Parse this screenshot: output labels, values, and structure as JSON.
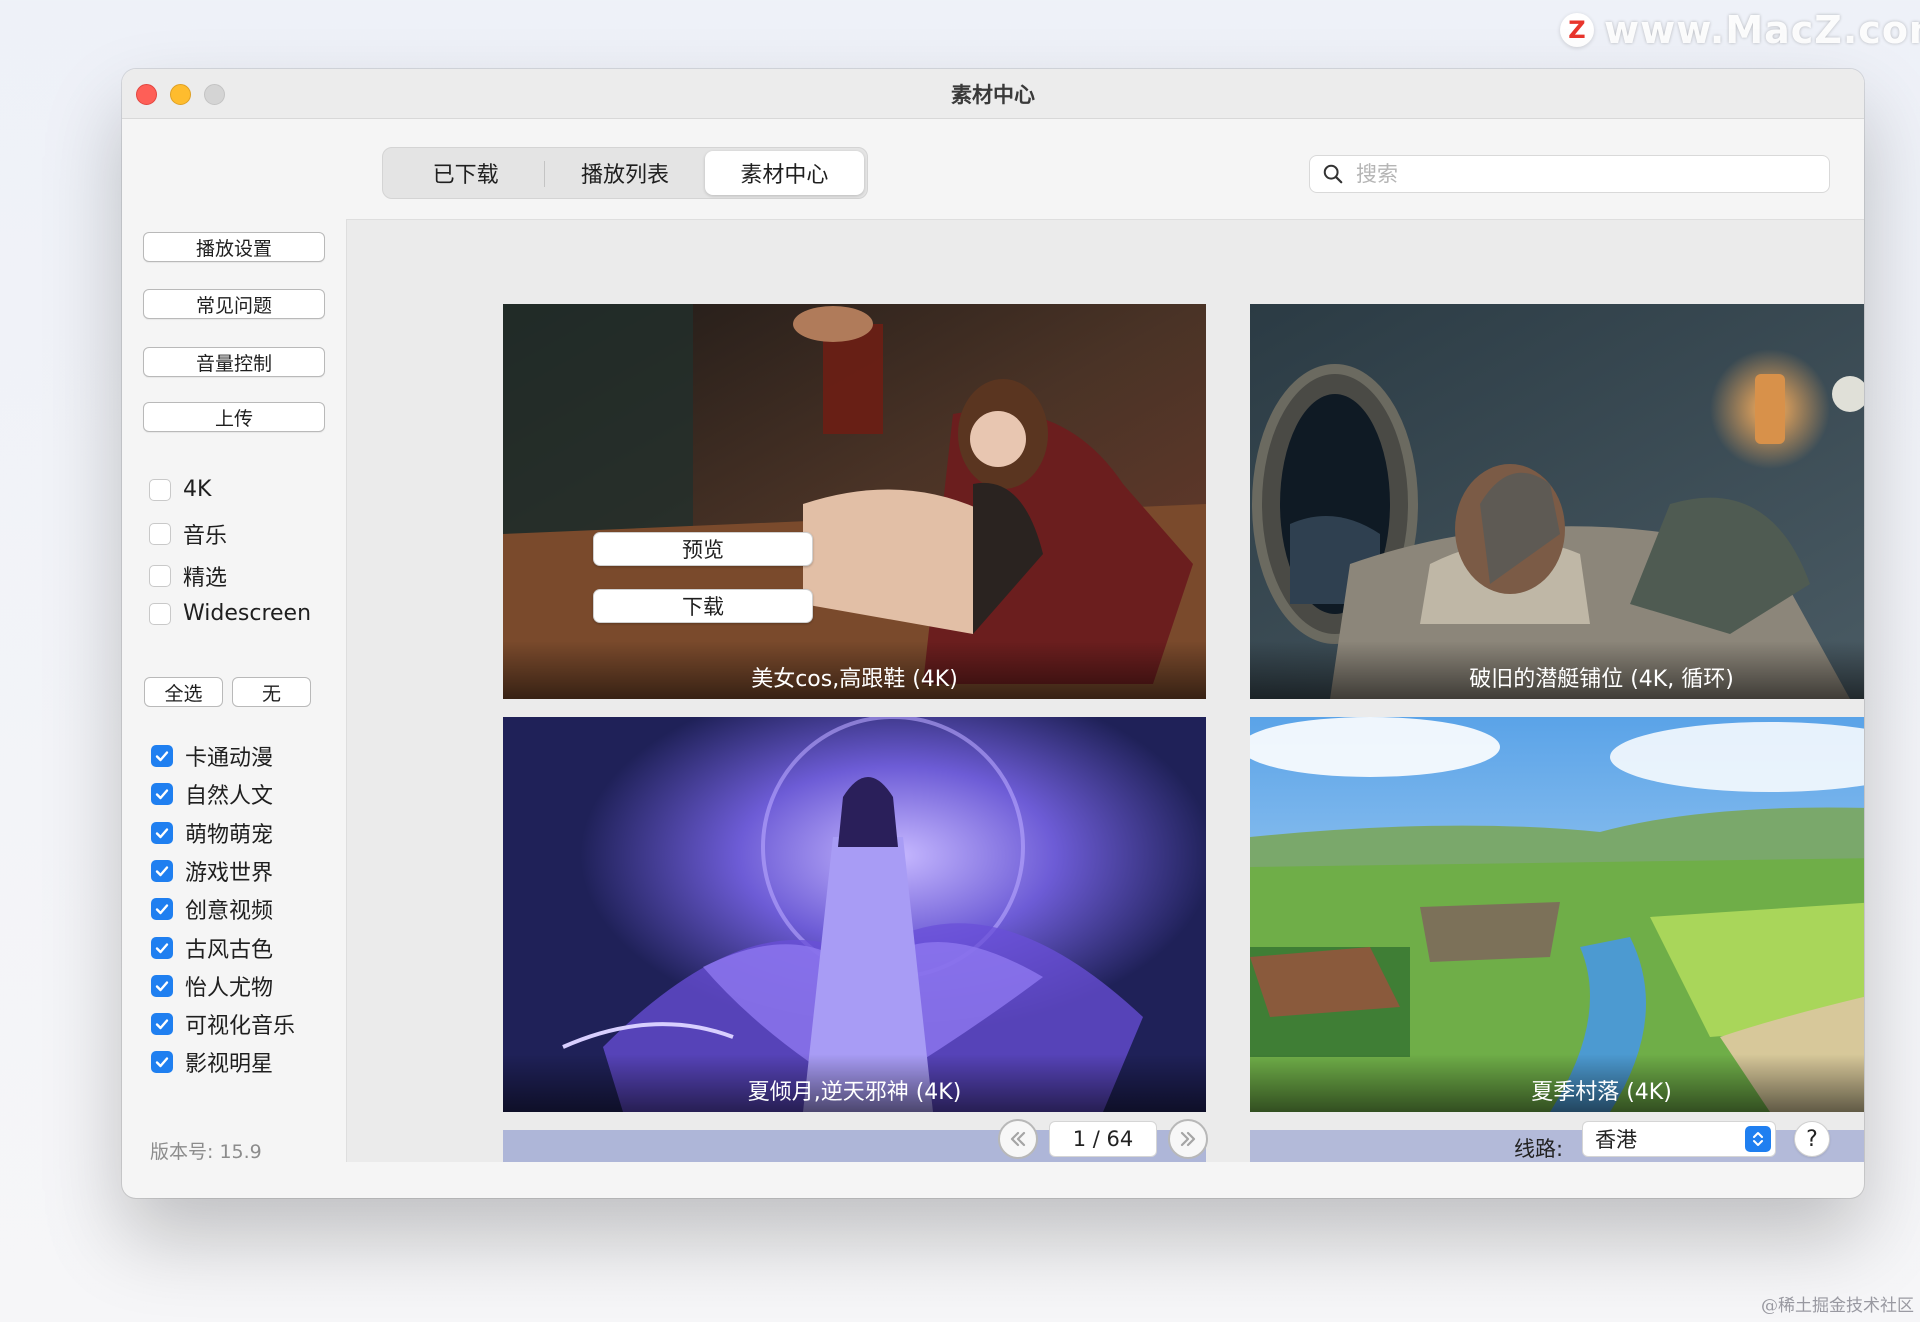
{
  "watermark": {
    "site": "www.MacZ.com",
    "logo_letter": "Z",
    "community": "@稀土掘金技术社区"
  },
  "window": {
    "title": "素材中心"
  },
  "tabs": [
    {
      "label": "已下载",
      "active": false
    },
    {
      "label": "播放列表",
      "active": false
    },
    {
      "label": "素材中心",
      "active": true
    }
  ],
  "search": {
    "placeholder": "搜索",
    "value": ""
  },
  "sidebar": {
    "buttons": [
      "播放设置",
      "常见问题",
      "音量控制",
      "上传"
    ],
    "filters": [
      {
        "label": "4K",
        "checked": false
      },
      {
        "label": "音乐",
        "checked": false
      },
      {
        "label": "精选",
        "checked": false
      },
      {
        "label": "Widescreen",
        "checked": false
      }
    ],
    "select_all": "全选",
    "select_none": "无",
    "categories": [
      {
        "label": "卡通动漫",
        "checked": true
      },
      {
        "label": "自然人文",
        "checked": true
      },
      {
        "label": "萌物萌宠",
        "checked": true
      },
      {
        "label": "游戏世界",
        "checked": true
      },
      {
        "label": "创意视频",
        "checked": true
      },
      {
        "label": "古风古色",
        "checked": true
      },
      {
        "label": "怡人尤物",
        "checked": true
      },
      {
        "label": "可视化音乐",
        "checked": true
      },
      {
        "label": "影视明星",
        "checked": true
      }
    ]
  },
  "cards": [
    {
      "caption": "美女cos,高跟鞋 (4K)",
      "preview_label": "预览",
      "download_label": "下载"
    },
    {
      "caption": "破旧的潜艇铺位 (4K, 循环)"
    },
    {
      "caption": "夏倾月,逆天邪神 (4K)"
    },
    {
      "caption": "夏季村落 (4K)"
    }
  ],
  "footer": {
    "version": "版本号: 15.9",
    "page": "1 / 64",
    "route_label": "线路:",
    "route_value": "香港",
    "help": "?"
  },
  "colors": {
    "accent": "#1f7ff0"
  }
}
